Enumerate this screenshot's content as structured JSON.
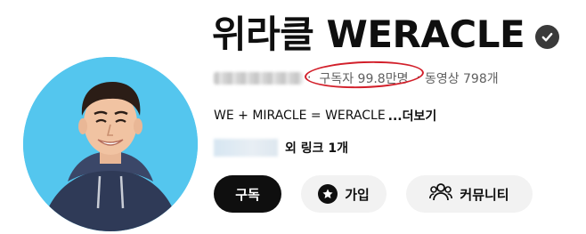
{
  "channel": {
    "name": "위라클 WERACLE",
    "verified": true
  },
  "meta": {
    "separator": "‧",
    "subscribers": "구독자 99.8만명",
    "videos": "동영상 798개",
    "highlight_color": "#d21f2a"
  },
  "description": {
    "text": "WE + MIRACLE = WERACLE",
    "more_label": "...더보기"
  },
  "links": {
    "label": "외 링크 1개"
  },
  "buttons": {
    "subscribe": "구독",
    "join": "가입",
    "community": "커뮤니티"
  },
  "icons": {
    "verified": "verified-check-icon",
    "join": "star-badge-icon",
    "community": "people-icon"
  },
  "colors": {
    "avatar_bg": "#54c6ee",
    "subscribe_bg": "#0f0f0f",
    "secondary_bg": "#f2f2f2"
  }
}
